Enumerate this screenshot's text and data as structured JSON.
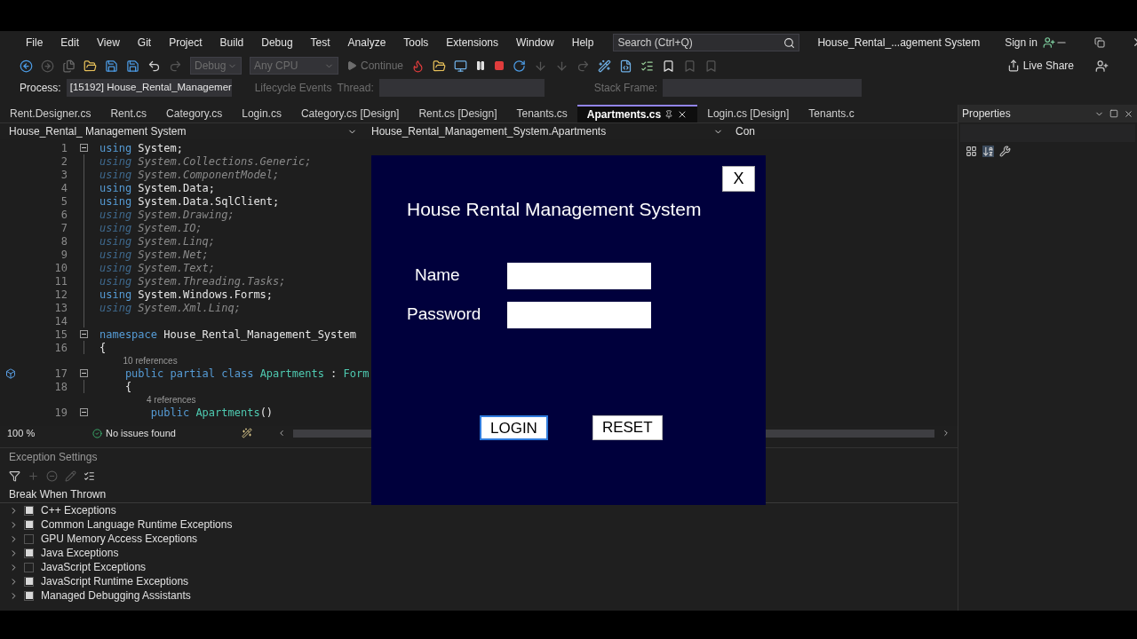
{
  "menu": [
    "File",
    "Edit",
    "View",
    "Git",
    "Project",
    "Build",
    "Debug",
    "Test",
    "Analyze",
    "Tools",
    "Extensions",
    "Window",
    "Help"
  ],
  "search": {
    "placeholder": "Search (Ctrl+Q)"
  },
  "window": {
    "title": "House_Rental_...agement System",
    "sign_in": "Sign in"
  },
  "toolbar": {
    "configuration": "Debug",
    "platform": "Any CPU",
    "continue": "Continue",
    "live_share": "Live Share"
  },
  "debug_bar": {
    "process_label": "Process:",
    "process": "[15192] House_Rental_Managemer",
    "lifecycle": "Lifecycle Events",
    "thread_label": "Thread:",
    "stack_frame_label": "Stack Frame:"
  },
  "tabs": [
    {
      "label": "Rent.Designer.cs",
      "selected": false
    },
    {
      "label": "Rent.cs",
      "selected": false
    },
    {
      "label": "Category.cs",
      "selected": false
    },
    {
      "label": "Login.cs",
      "selected": false
    },
    {
      "label": "Category.cs [Design]",
      "selected": false
    },
    {
      "label": "Rent.cs [Design]",
      "selected": false
    },
    {
      "label": "Tenants.cs",
      "selected": false
    },
    {
      "label": "Apartments.cs",
      "selected": true
    },
    {
      "label": "Login.cs [Design]",
      "selected": false
    },
    {
      "label": "Tenants.c",
      "selected": false
    }
  ],
  "nav_bar": {
    "project": "House_Rental_ Management System",
    "type": "House_Rental_Management_System.Apartments",
    "member": "Con"
  },
  "code": [
    {
      "kind": "code",
      "number": "1",
      "dimmed": false,
      "fold": true,
      "tokens": [
        {
          "kind": "keyword",
          "text": "using"
        },
        {
          "kind": "plain",
          "text": " System;"
        }
      ]
    },
    {
      "kind": "code",
      "number": "2",
      "dimmed": true,
      "fold": false,
      "tokens": [
        {
          "kind": "keyword",
          "text": "using"
        },
        {
          "kind": "plain",
          "text": " System.Collections.Generic;"
        }
      ]
    },
    {
      "kind": "code",
      "number": "3",
      "dimmed": true,
      "fold": false,
      "tokens": [
        {
          "kind": "keyword",
          "text": "using"
        },
        {
          "kind": "plain",
          "text": " System.ComponentModel;"
        }
      ]
    },
    {
      "kind": "code",
      "number": "4",
      "dimmed": false,
      "fold": false,
      "tokens": [
        {
          "kind": "keyword",
          "text": "using"
        },
        {
          "kind": "plain",
          "text": " System.Data;"
        }
      ]
    },
    {
      "kind": "code",
      "number": "5",
      "dimmed": false,
      "fold": false,
      "tokens": [
        {
          "kind": "keyword",
          "text": "using"
        },
        {
          "kind": "plain",
          "text": " System.Data.SqlClient;"
        }
      ]
    },
    {
      "kind": "code",
      "number": "6",
      "dimmed": true,
      "fold": false,
      "tokens": [
        {
          "kind": "keyword",
          "text": "using"
        },
        {
          "kind": "plain",
          "text": " System.Drawing;"
        }
      ]
    },
    {
      "kind": "code",
      "number": "7",
      "dimmed": true,
      "fold": false,
      "tokens": [
        {
          "kind": "keyword",
          "text": "using"
        },
        {
          "kind": "plain",
          "text": " System.IO;"
        }
      ]
    },
    {
      "kind": "code",
      "number": "8",
      "dimmed": true,
      "fold": false,
      "tokens": [
        {
          "kind": "keyword",
          "text": "using"
        },
        {
          "kind": "plain",
          "text": " System.Linq;"
        }
      ]
    },
    {
      "kind": "code",
      "number": "9",
      "dimmed": true,
      "fold": false,
      "tokens": [
        {
          "kind": "keyword",
          "text": "using"
        },
        {
          "kind": "plain",
          "text": " System.Net;"
        }
      ]
    },
    {
      "kind": "code",
      "number": "10",
      "dimmed": true,
      "fold": false,
      "tokens": [
        {
          "kind": "keyword",
          "text": "using"
        },
        {
          "kind": "plain",
          "text": " System.Text;"
        }
      ]
    },
    {
      "kind": "code",
      "number": "11",
      "dimmed": true,
      "fold": false,
      "tokens": [
        {
          "kind": "keyword",
          "text": "using"
        },
        {
          "kind": "plain",
          "text": " System.Threading.Tasks;"
        }
      ]
    },
    {
      "kind": "code",
      "number": "12",
      "dimmed": false,
      "fold": false,
      "tokens": [
        {
          "kind": "keyword",
          "text": "using"
        },
        {
          "kind": "plain",
          "text": " System.Windows.Forms;"
        }
      ]
    },
    {
      "kind": "code",
      "number": "13",
      "dimmed": true,
      "fold": false,
      "tokens": [
        {
          "kind": "keyword",
          "text": "using"
        },
        {
          "kind": "plain",
          "text": " System.Xml.Linq;"
        }
      ]
    },
    {
      "kind": "code",
      "number": "14",
      "fold": false
    },
    {
      "kind": "code",
      "number": "15",
      "dimmed": false,
      "fold": true,
      "tokens": [
        {
          "kind": "keyword",
          "text": "namespace"
        },
        {
          "kind": "plain",
          "text": " House_Rental_Management_System"
        }
      ]
    },
    {
      "kind": "code",
      "number": "16",
      "dimmed": false,
      "fold": false,
      "tokens": [
        {
          "kind": "plain",
          "text": "{"
        }
      ]
    },
    {
      "kind": "lens",
      "text": "10 references"
    },
    {
      "kind": "code",
      "number": "17",
      "dimmed": false,
      "fold": true,
      "gutter_icon": true,
      "tokens": [
        {
          "kind": "keyword",
          "text": "    public partial class "
        },
        {
          "kind": "type",
          "text": "Apartments"
        },
        {
          "kind": "plain",
          "text": " : "
        },
        {
          "kind": "type",
          "text": "Form"
        }
      ]
    },
    {
      "kind": "code",
      "number": "18",
      "dimmed": false,
      "fold": false,
      "tokens": [
        {
          "kind": "plain",
          "text": "    {"
        }
      ]
    },
    {
      "kind": "lens",
      "text": "4 references"
    },
    {
      "kind": "code",
      "number": "19",
      "dimmed": false,
      "fold": true,
      "tokens": [
        {
          "kind": "keyword",
          "text": "        public "
        },
        {
          "kind": "type",
          "text": "Apartments"
        },
        {
          "kind": "plain",
          "text": "()"
        }
      ]
    }
  ],
  "editor_status": {
    "zoom": "100 %",
    "issues": "No issues found"
  },
  "exception_settings": {
    "title": "Exception Settings",
    "column": "Break When Thrown",
    "items": [
      {
        "label": "C++ Exceptions",
        "checked": true
      },
      {
        "label": "Common Language Runtime Exceptions",
        "checked": true
      },
      {
        "label": "GPU Memory Access Exceptions",
        "checked": false
      },
      {
        "label": "Java Exceptions",
        "checked": true
      },
      {
        "label": "JavaScript Exceptions",
        "checked": false
      },
      {
        "label": "JavaScript Runtime Exceptions",
        "checked": true
      },
      {
        "label": "Managed Debugging Assistants",
        "checked": true
      }
    ]
  },
  "properties": {
    "title": "Properties"
  },
  "login_form": {
    "close": "X",
    "title": "House Rental Management System",
    "fields": [
      {
        "label": "Name"
      },
      {
        "label": "Password"
      }
    ],
    "buttons": [
      {
        "label": "LOGIN",
        "focused": true
      },
      {
        "label": "RESET",
        "focused": false
      }
    ]
  }
}
